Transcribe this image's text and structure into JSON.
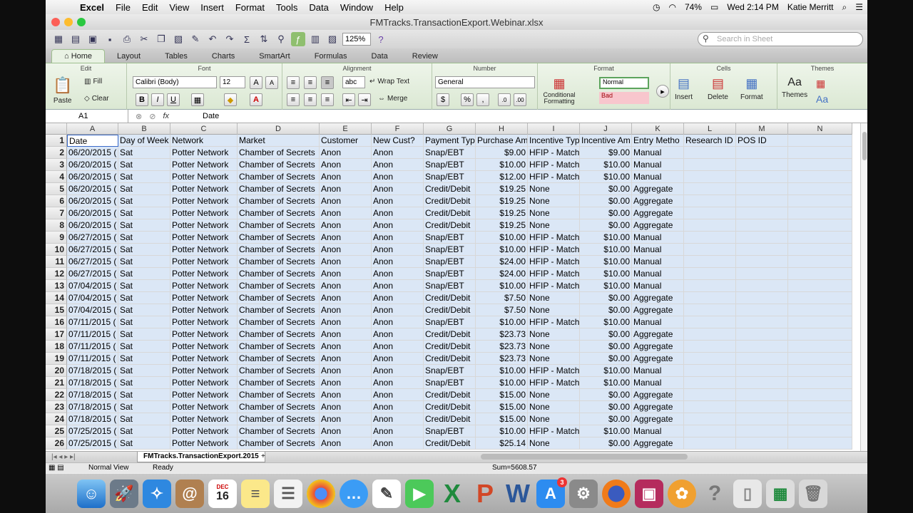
{
  "menubar": {
    "app": "Excel",
    "items": [
      "File",
      "Edit",
      "View",
      "Insert",
      "Format",
      "Tools",
      "Data",
      "Window",
      "Help"
    ],
    "battery": "74%",
    "clock": "Wed 2:14 PM",
    "user": "Katie Merritt"
  },
  "window": {
    "title": "FMTracks.TransactionExport.Webinar.xlsx"
  },
  "toolbar": {
    "zoom": "125%",
    "search_placeholder": "Search in Sheet"
  },
  "ribbon": {
    "tabs": [
      "Home",
      "Layout",
      "Tables",
      "Charts",
      "SmartArt",
      "Formulas",
      "Data",
      "Review"
    ],
    "active_tab": "Home",
    "groups": {
      "edit": "Edit",
      "font": "Font",
      "alignment": "Alignment",
      "number": "Number",
      "format": "Format",
      "cells": "Cells",
      "themes": "Themes"
    },
    "paste": "Paste",
    "fill": "Fill",
    "clear": "Clear",
    "font_name": "Calibri (Body)",
    "font_size": "12",
    "bold": "B",
    "italic": "I",
    "underline": "U",
    "abc": "abc",
    "wrap_text": "Wrap Text",
    "merge": "Merge",
    "number_format": "General",
    "percent": "%",
    "comma": ",",
    "conditional_formatting": "Conditional Formatting",
    "style_normal": "Normal",
    "style_bad": "Bad",
    "insert": "Insert",
    "delete": "Delete",
    "format": "Format",
    "themes": "Themes"
  },
  "formula_bar": {
    "name_box": "A1",
    "fx": "fx",
    "content": "Date"
  },
  "columns": [
    "A",
    "B",
    "C",
    "D",
    "E",
    "F",
    "G",
    "H",
    "I",
    "J",
    "K",
    "L",
    "M",
    "N"
  ],
  "rows": [
    [
      "Date",
      "Day of Week",
      "Network",
      "Market",
      "Customer",
      "New Cust?",
      "Payment Typ",
      "Purchase Am",
      "Incentive Typ",
      "Incentive Am",
      "Entry Metho",
      "Research ID",
      "POS ID",
      ""
    ],
    [
      "06/20/2015 (",
      "Sat",
      "Potter Network",
      "Chamber of Secrets",
      "Anon",
      "Anon",
      "Snap/EBT",
      "$9.00",
      "HFIP - Match",
      "$9.00",
      "Manual",
      "",
      "",
      ""
    ],
    [
      "06/20/2015 (",
      "Sat",
      "Potter Network",
      "Chamber of Secrets",
      "Anon",
      "Anon",
      "Snap/EBT",
      "$10.00",
      "HFIP - Match",
      "$10.00",
      "Manual",
      "",
      "",
      ""
    ],
    [
      "06/20/2015 (",
      "Sat",
      "Potter Network",
      "Chamber of Secrets",
      "Anon",
      "Anon",
      "Snap/EBT",
      "$12.00",
      "HFIP - Match",
      "$10.00",
      "Manual",
      "",
      "",
      ""
    ],
    [
      "06/20/2015 (",
      "Sat",
      "Potter Network",
      "Chamber of Secrets",
      "Anon",
      "Anon",
      "Credit/Debit",
      "$19.25",
      "None",
      "$0.00",
      "Aggregate",
      "",
      "",
      ""
    ],
    [
      "06/20/2015 (",
      "Sat",
      "Potter Network",
      "Chamber of Secrets",
      "Anon",
      "Anon",
      "Credit/Debit",
      "$19.25",
      "None",
      "$0.00",
      "Aggregate",
      "",
      "",
      ""
    ],
    [
      "06/20/2015 (",
      "Sat",
      "Potter Network",
      "Chamber of Secrets",
      "Anon",
      "Anon",
      "Credit/Debit",
      "$19.25",
      "None",
      "$0.00",
      "Aggregate",
      "",
      "",
      ""
    ],
    [
      "06/20/2015 (",
      "Sat",
      "Potter Network",
      "Chamber of Secrets",
      "Anon",
      "Anon",
      "Credit/Debit",
      "$19.25",
      "None",
      "$0.00",
      "Aggregate",
      "",
      "",
      ""
    ],
    [
      "06/27/2015 (",
      "Sat",
      "Potter Network",
      "Chamber of Secrets",
      "Anon",
      "Anon",
      "Snap/EBT",
      "$10.00",
      "HFIP - Match",
      "$10.00",
      "Manual",
      "",
      "",
      ""
    ],
    [
      "06/27/2015 (",
      "Sat",
      "Potter Network",
      "Chamber of Secrets",
      "Anon",
      "Anon",
      "Snap/EBT",
      "$10.00",
      "HFIP - Match",
      "$10.00",
      "Manual",
      "",
      "",
      ""
    ],
    [
      "06/27/2015 (",
      "Sat",
      "Potter Network",
      "Chamber of Secrets",
      "Anon",
      "Anon",
      "Snap/EBT",
      "$24.00",
      "HFIP - Match",
      "$10.00",
      "Manual",
      "",
      "",
      ""
    ],
    [
      "06/27/2015 (",
      "Sat",
      "Potter Network",
      "Chamber of Secrets",
      "Anon",
      "Anon",
      "Snap/EBT",
      "$24.00",
      "HFIP - Match",
      "$10.00",
      "Manual",
      "",
      "",
      ""
    ],
    [
      "07/04/2015 (",
      "Sat",
      "Potter Network",
      "Chamber of Secrets",
      "Anon",
      "Anon",
      "Snap/EBT",
      "$10.00",
      "HFIP - Match",
      "$10.00",
      "Manual",
      "",
      "",
      ""
    ],
    [
      "07/04/2015 (",
      "Sat",
      "Potter Network",
      "Chamber of Secrets",
      "Anon",
      "Anon",
      "Credit/Debit",
      "$7.50",
      "None",
      "$0.00",
      "Aggregate",
      "",
      "",
      ""
    ],
    [
      "07/04/2015 (",
      "Sat",
      "Potter Network",
      "Chamber of Secrets",
      "Anon",
      "Anon",
      "Credit/Debit",
      "$7.50",
      "None",
      "$0.00",
      "Aggregate",
      "",
      "",
      ""
    ],
    [
      "07/11/2015 (",
      "Sat",
      "Potter Network",
      "Chamber of Secrets",
      "Anon",
      "Anon",
      "Snap/EBT",
      "$10.00",
      "HFIP - Match",
      "$10.00",
      "Manual",
      "",
      "",
      ""
    ],
    [
      "07/11/2015 (",
      "Sat",
      "Potter Network",
      "Chamber of Secrets",
      "Anon",
      "Anon",
      "Credit/Debit",
      "$23.73",
      "None",
      "$0.00",
      "Aggregate",
      "",
      "",
      ""
    ],
    [
      "07/11/2015 (",
      "Sat",
      "Potter Network",
      "Chamber of Secrets",
      "Anon",
      "Anon",
      "Credit/Debit",
      "$23.73",
      "None",
      "$0.00",
      "Aggregate",
      "",
      "",
      ""
    ],
    [
      "07/11/2015 (",
      "Sat",
      "Potter Network",
      "Chamber of Secrets",
      "Anon",
      "Anon",
      "Credit/Debit",
      "$23.73",
      "None",
      "$0.00",
      "Aggregate",
      "",
      "",
      ""
    ],
    [
      "07/18/2015 (",
      "Sat",
      "Potter Network",
      "Chamber of Secrets",
      "Anon",
      "Anon",
      "Snap/EBT",
      "$10.00",
      "HFIP - Match",
      "$10.00",
      "Manual",
      "",
      "",
      ""
    ],
    [
      "07/18/2015 (",
      "Sat",
      "Potter Network",
      "Chamber of Secrets",
      "Anon",
      "Anon",
      "Snap/EBT",
      "$10.00",
      "HFIP - Match",
      "$10.00",
      "Manual",
      "",
      "",
      ""
    ],
    [
      "07/18/2015 (",
      "Sat",
      "Potter Network",
      "Chamber of Secrets",
      "Anon",
      "Anon",
      "Credit/Debit",
      "$15.00",
      "None",
      "$0.00",
      "Aggregate",
      "",
      "",
      ""
    ],
    [
      "07/18/2015 (",
      "Sat",
      "Potter Network",
      "Chamber of Secrets",
      "Anon",
      "Anon",
      "Credit/Debit",
      "$15.00",
      "None",
      "$0.00",
      "Aggregate",
      "",
      "",
      ""
    ],
    [
      "07/18/2015 (",
      "Sat",
      "Potter Network",
      "Chamber of Secrets",
      "Anon",
      "Anon",
      "Credit/Debit",
      "$15.00",
      "None",
      "$0.00",
      "Aggregate",
      "",
      "",
      ""
    ],
    [
      "07/25/2015 (",
      "Sat",
      "Potter Network",
      "Chamber of Secrets",
      "Anon",
      "Anon",
      "Snap/EBT",
      "$10.00",
      "HFIP - Match",
      "$10.00",
      "Manual",
      "",
      "",
      ""
    ],
    [
      "07/25/2015 (",
      "Sat",
      "Potter Network",
      "Chamber of Secrets",
      "Anon",
      "Anon",
      "Credit/Debit",
      "$25.14",
      "None",
      "$0.00",
      "Aggregate",
      "",
      "",
      ""
    ]
  ],
  "sheet_tab": "FMTracks.TransactionExport.2015",
  "status": {
    "view": "Normal View",
    "mode": "Ready",
    "sum": "Sum=5608.57"
  },
  "dock": {
    "calendar_month": "DEC",
    "calendar_day": "16",
    "appstore_badge": "3"
  },
  "colors": {
    "selection": "#dbe7f6",
    "ribbon": "#e9f2e4",
    "accent": "#3a6ac9"
  }
}
